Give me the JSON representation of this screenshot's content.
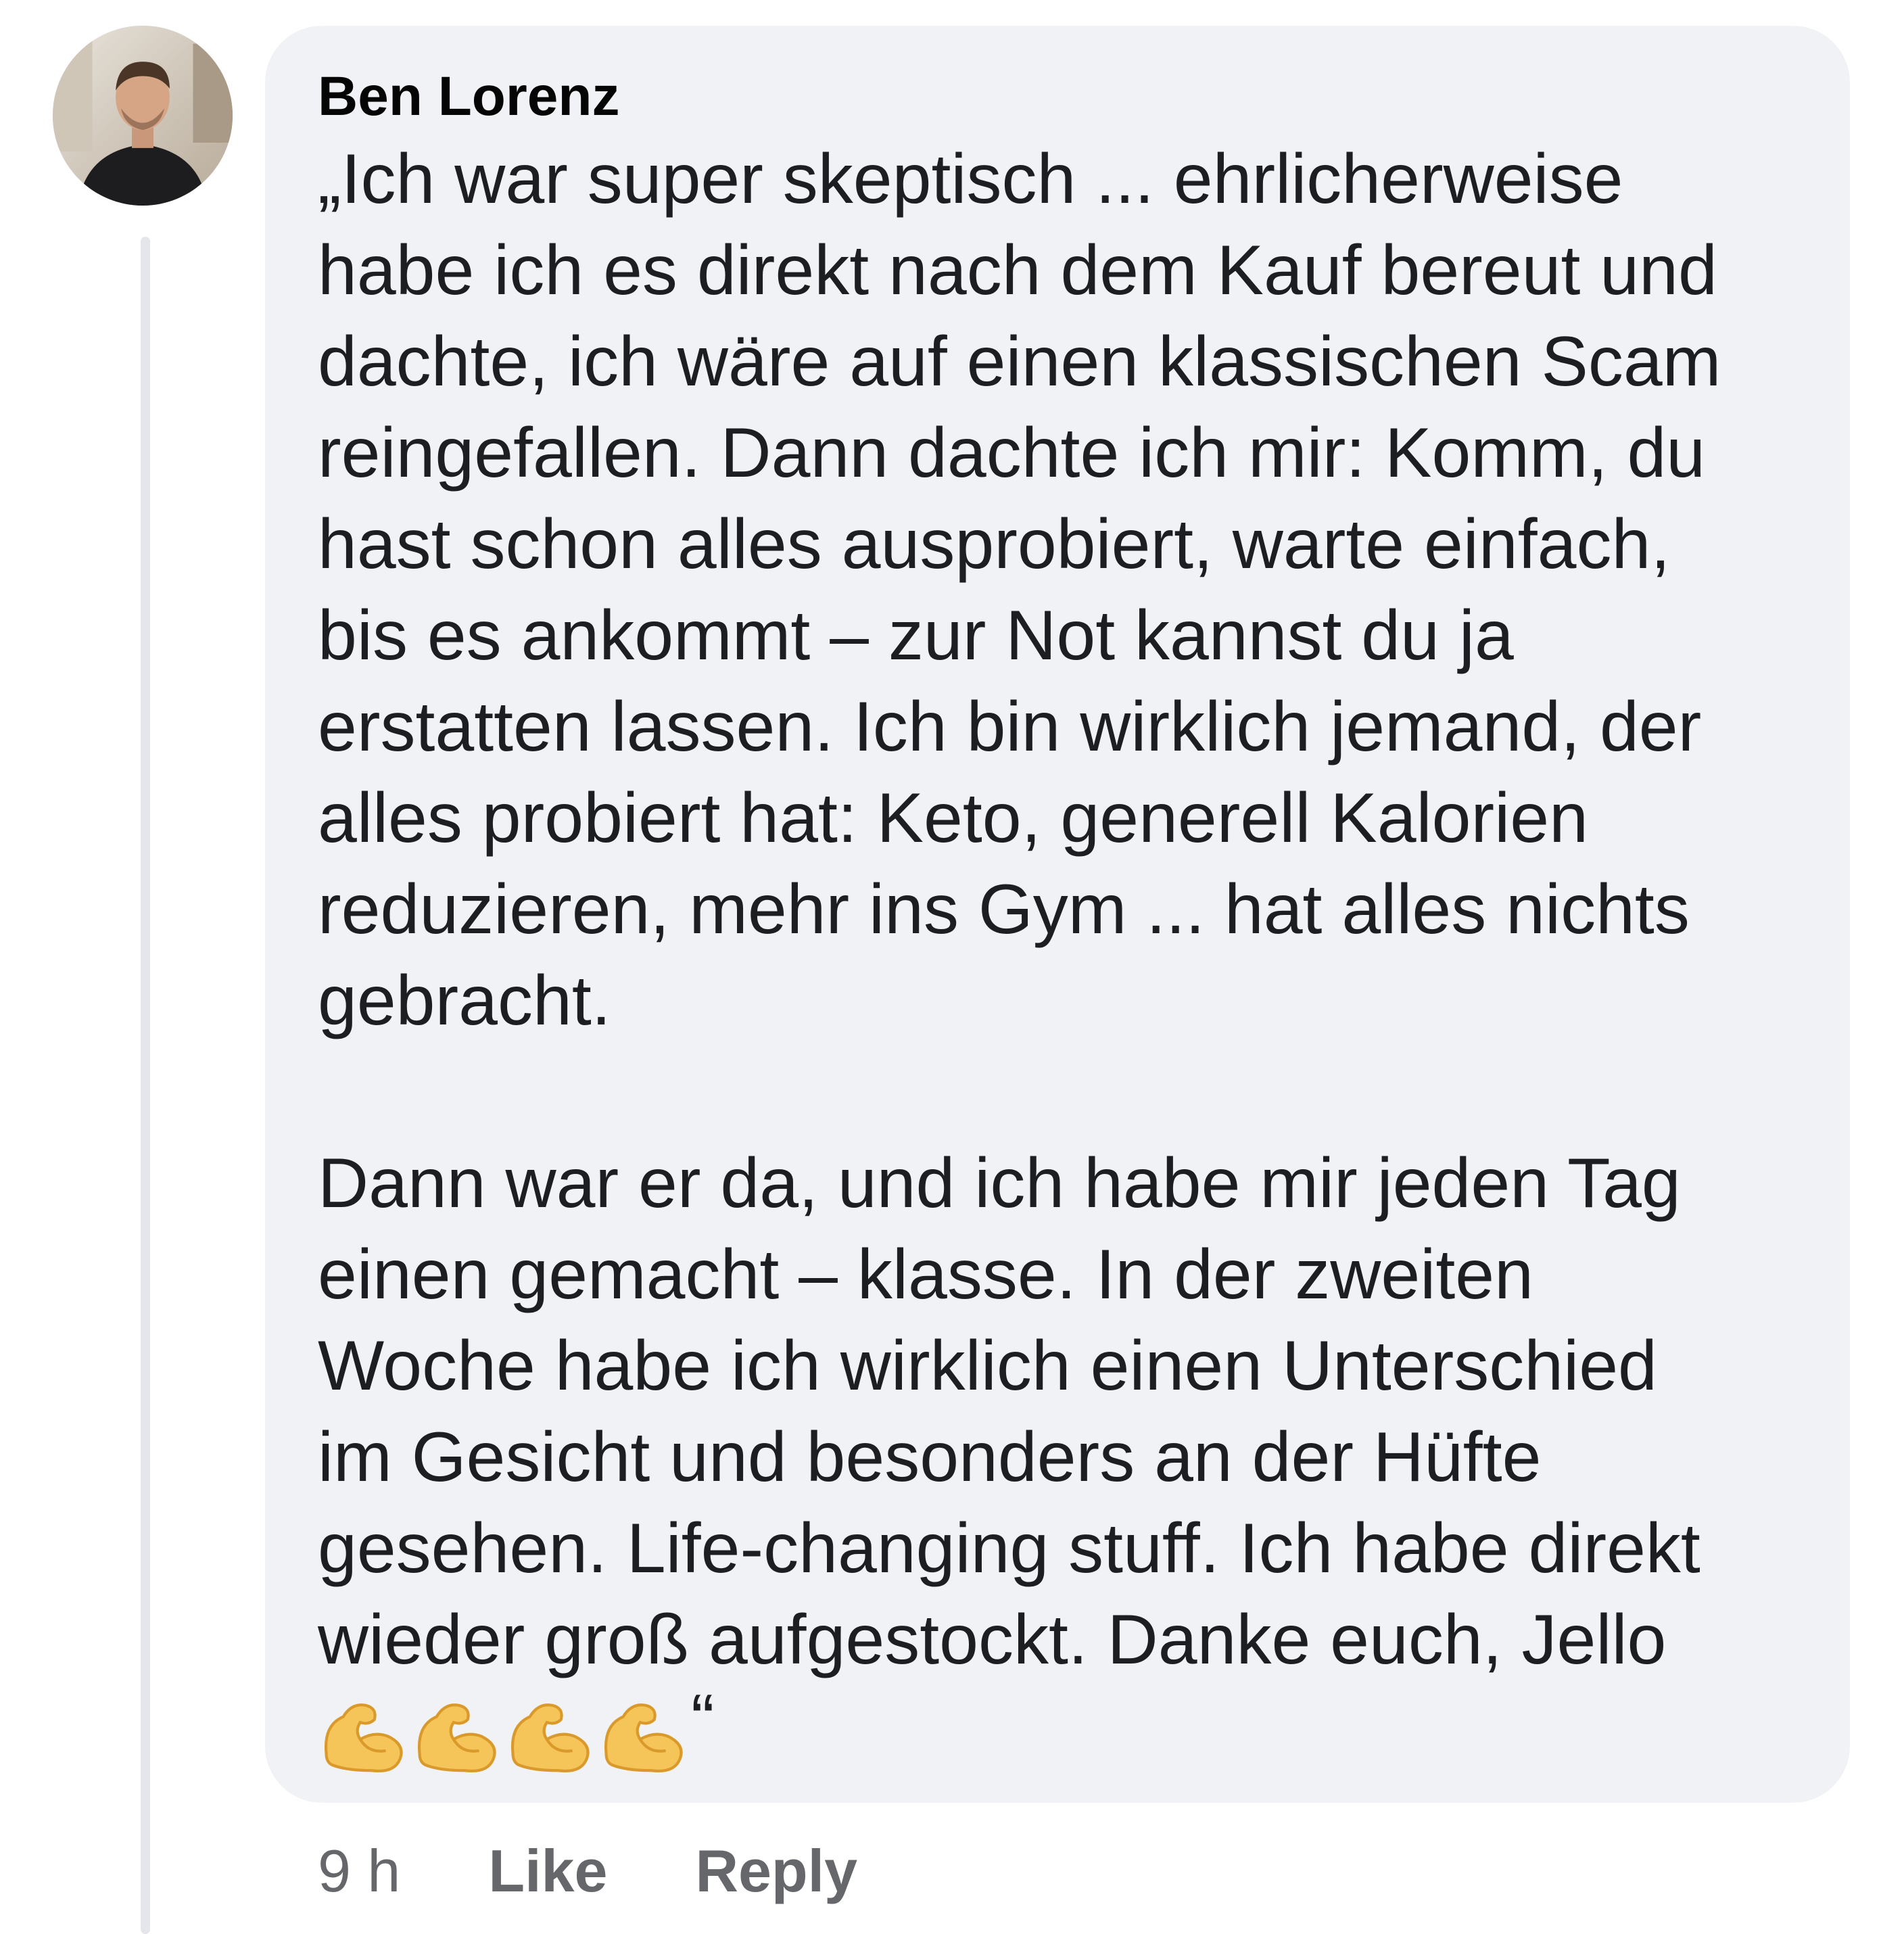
{
  "comment": {
    "author": "Ben Lorenz",
    "paragraph1": "„Ich war super skeptisch ... ehrlicherweise\nhabe ich es direkt nach dem Kauf bereut und\ndachte, ich wäre auf einen klassischen Scam\nreingefallen. Dann dachte ich mir: Komm, du\nhast schon alles ausprobiert, warte einfach,\nbis es ankommt – zur Not kannst du ja\nerstatten lassen. Ich bin wirklich jemand, der\nalles probiert hat: Keto, generell Kalorien\nreduzieren, mehr ins Gym ... hat alles nichts\ngebracht.",
    "paragraph2": "Dann war er da, und ich habe mir jeden Tag\neinen gemacht – klasse. In der zweiten\nWoche habe ich wirklich einen Unterschied\nim Gesicht und besonders an der Hüfte\ngesehen. Life-changing stuff. Ich habe direkt\nwieder groß aufgestockt. Danke euch, Jello",
    "emojis": [
      "flexed-biceps-emoji",
      "flexed-biceps-emoji",
      "flexed-biceps-emoji",
      "flexed-biceps-emoji"
    ],
    "closing_quote": "“"
  },
  "actions": {
    "time": "9 h",
    "like": "Like",
    "reply": "Reply"
  },
  "colors": {
    "bubble_background": "#f0f2f5",
    "action_text": "#65676b",
    "emoji_yellow": "#f5c55a"
  }
}
